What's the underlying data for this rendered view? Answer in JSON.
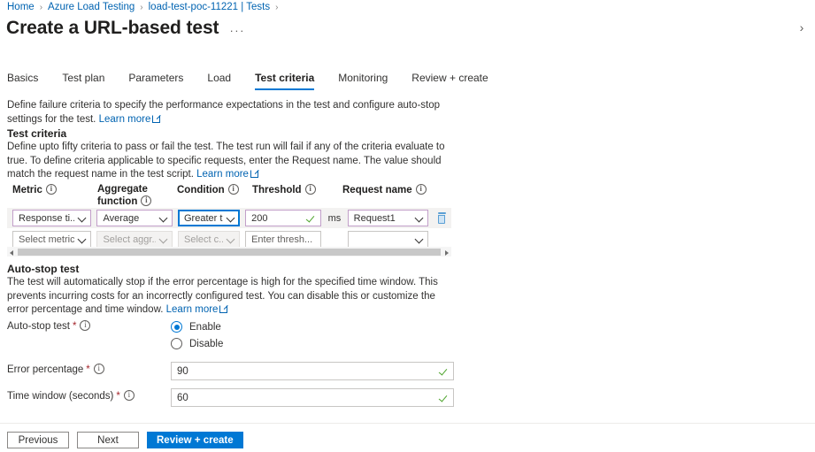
{
  "breadcrumb": {
    "items": [
      {
        "label": "Home"
      },
      {
        "label": "Azure Load Testing"
      },
      {
        "label": "load-test-poc-11221 | Tests"
      }
    ],
    "separator": "›"
  },
  "header": {
    "title": "Create a URL-based test",
    "ellipsis": "···",
    "collapse_icon": "›"
  },
  "tabs": [
    {
      "label": "Basics",
      "active": false
    },
    {
      "label": "Test plan",
      "active": false
    },
    {
      "label": "Parameters",
      "active": false
    },
    {
      "label": "Load",
      "active": false
    },
    {
      "label": "Test criteria",
      "active": true
    },
    {
      "label": "Monitoring",
      "active": false
    },
    {
      "label": "Review + create",
      "active": false
    }
  ],
  "intro": {
    "text": "Define failure criteria to specify the performance expectations in the test and configure auto-stop settings for the test.",
    "learn_more": "Learn more"
  },
  "test_criteria": {
    "heading": "Test criteria",
    "description_part1": "Define upto fifty criteria to pass or fail the test. The test run will fail if any of the criteria evaluate to true. To define criteria applicable to specific requests, enter the Request name. The value should match the request name in the test script. ",
    "learn_more": "Learn more",
    "columns": [
      {
        "label": "Metric"
      },
      {
        "label": "Aggregate function"
      },
      {
        "label": "Condition"
      },
      {
        "label": "Threshold"
      },
      {
        "label": "Request name"
      }
    ],
    "rows": [
      {
        "metric": "Response ti...",
        "aggregate": "Average",
        "condition": "Greater t...",
        "threshold": "200",
        "unit": "ms",
        "request_name": "Request1",
        "delete_label": "Delete criteria"
      },
      {
        "metric_placeholder": "Select metric",
        "aggregate_placeholder": "Select aggr...",
        "condition_placeholder": "Select c...",
        "threshold_placeholder": "Enter thresh...",
        "unit": "",
        "request_name": ""
      }
    ]
  },
  "auto_stop": {
    "heading": "Auto-stop test",
    "description_part1": "The test will automatically stop if the error percentage is high for the specified time window. This prevents incurring costs for an incorrectly configured test. You can disable this or customize the error percentage and time window. ",
    "learn_more": "Learn more",
    "toggle_label": "Auto-stop test",
    "options": [
      {
        "label": "Enable",
        "selected": true
      },
      {
        "label": "Disable",
        "selected": false
      }
    ],
    "error_percentage_label": "Error percentage",
    "error_percentage_value": "90",
    "time_window_label": "Time window (seconds)",
    "time_window_value": "60"
  },
  "footer": {
    "previous": "Previous",
    "next": "Next",
    "review_create": "Review + create"
  },
  "colors": {
    "accent": "#0078d4",
    "link": "#0063b1",
    "required": "#a4262c",
    "valid": "#4ca32a",
    "field_border_modified": "#c29fc9",
    "delete_icon": "#5a9fd4"
  }
}
